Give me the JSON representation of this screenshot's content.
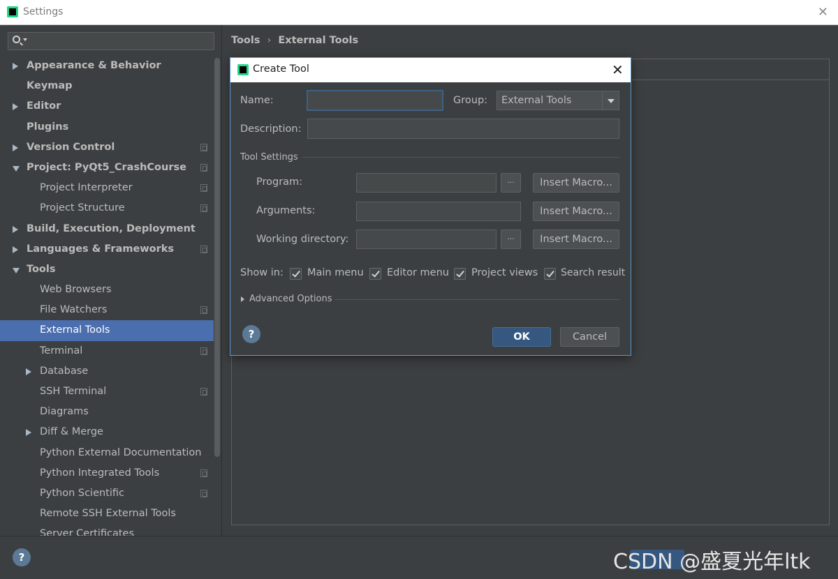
{
  "window": {
    "title": "Settings"
  },
  "search": {
    "placeholder": ""
  },
  "sidebar": {
    "items": [
      {
        "label": "Appearance & Behavior",
        "level": 0,
        "bold": true,
        "arrow": "right",
        "copy": false
      },
      {
        "label": "Keymap",
        "level": 0,
        "bold": true,
        "arrow": "",
        "copy": false
      },
      {
        "label": "Editor",
        "level": 0,
        "bold": true,
        "arrow": "right",
        "copy": false
      },
      {
        "label": "Plugins",
        "level": 0,
        "bold": true,
        "arrow": "",
        "copy": false
      },
      {
        "label": "Version Control",
        "level": 0,
        "bold": true,
        "arrow": "right",
        "copy": true
      },
      {
        "label": "Project: PyQt5_CrashCourse",
        "level": 0,
        "bold": true,
        "arrow": "down",
        "copy": true
      },
      {
        "label": "Project Interpreter",
        "level": 1,
        "bold": false,
        "arrow": "",
        "copy": true
      },
      {
        "label": "Project Structure",
        "level": 1,
        "bold": false,
        "arrow": "",
        "copy": true
      },
      {
        "label": "Build, Execution, Deployment",
        "level": 0,
        "bold": true,
        "arrow": "right",
        "copy": false
      },
      {
        "label": "Languages & Frameworks",
        "level": 0,
        "bold": true,
        "arrow": "right",
        "copy": true
      },
      {
        "label": "Tools",
        "level": 0,
        "bold": true,
        "arrow": "down",
        "copy": false
      },
      {
        "label": "Web Browsers",
        "level": 1,
        "bold": false,
        "arrow": "",
        "copy": false
      },
      {
        "label": "File Watchers",
        "level": 1,
        "bold": false,
        "arrow": "",
        "copy": true
      },
      {
        "label": "External Tools",
        "level": 1,
        "bold": false,
        "arrow": "",
        "copy": false,
        "selected": true
      },
      {
        "label": "Terminal",
        "level": 1,
        "bold": false,
        "arrow": "",
        "copy": true
      },
      {
        "label": "Database",
        "level": 1,
        "bold": false,
        "arrow": "right",
        "copy": false
      },
      {
        "label": "SSH Terminal",
        "level": 1,
        "bold": false,
        "arrow": "",
        "copy": true
      },
      {
        "label": "Diagrams",
        "level": 1,
        "bold": false,
        "arrow": "",
        "copy": false
      },
      {
        "label": "Diff & Merge",
        "level": 1,
        "bold": false,
        "arrow": "right",
        "copy": false
      },
      {
        "label": "Python External Documentation",
        "level": 1,
        "bold": false,
        "arrow": "",
        "copy": false
      },
      {
        "label": "Python Integrated Tools",
        "level": 1,
        "bold": false,
        "arrow": "",
        "copy": true
      },
      {
        "label": "Python Scientific",
        "level": 1,
        "bold": false,
        "arrow": "",
        "copy": true
      },
      {
        "label": "Remote SSH External Tools",
        "level": 1,
        "bold": false,
        "arrow": "",
        "copy": false
      },
      {
        "label": "Server Certificates",
        "level": 1,
        "bold": false,
        "arrow": "",
        "copy": false
      }
    ]
  },
  "breadcrumb": {
    "parent": "Tools",
    "separator": "›",
    "current": "External Tools"
  },
  "dialog": {
    "title": "Create Tool",
    "name_label": "Name:",
    "name_value": "",
    "group_label": "Group:",
    "group_value": "External Tools",
    "description_label": "Description:",
    "description_value": "",
    "tool_settings_label": "Tool Settings",
    "program_label": "Program:",
    "program_value": "",
    "arguments_label": "Arguments:",
    "arguments_value": "",
    "working_dir_label": "Working directory:",
    "working_dir_value": "",
    "browse_label": "...",
    "insert_macro_label": "Insert Macro...",
    "show_in_label": "Show in:",
    "show_in": [
      {
        "label": "Main menu",
        "checked": true
      },
      {
        "label": "Editor menu",
        "checked": true
      },
      {
        "label": "Project views",
        "checked": true
      },
      {
        "label": "Search result",
        "checked": true
      }
    ],
    "advanced_label": "Advanced Options",
    "ok_label": "OK",
    "cancel_label": "Cancel",
    "help_glyph": "?"
  },
  "footer": {
    "help_glyph": "?"
  },
  "watermark": "CSDN @盛夏光年ltk",
  "colors": {
    "selection": "#4b6eaf",
    "accent_border": "#5a9bd5",
    "ok_button": "#365880",
    "background": "#3c3f41"
  }
}
